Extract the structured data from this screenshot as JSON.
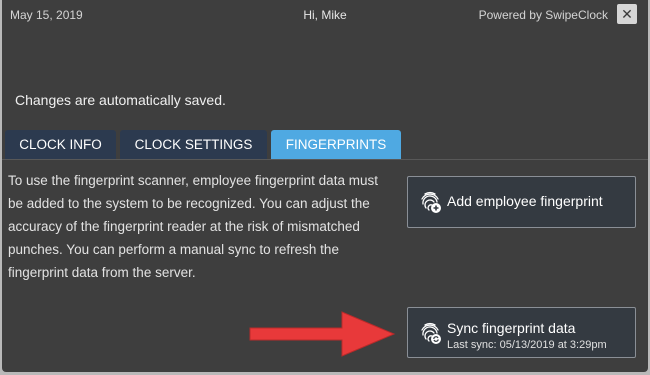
{
  "header": {
    "date": "May 15, 2019",
    "greeting": "Hi, Mike",
    "powered_by": "Powered by SwipeClock",
    "close_glyph": "✕"
  },
  "notice": "Changes are automatically saved.",
  "tabs": [
    {
      "label": "CLOCK INFO",
      "active": false
    },
    {
      "label": "CLOCK SETTINGS",
      "active": false
    },
    {
      "label": "FINGERPRINTS",
      "active": true
    }
  ],
  "description": "To use the fingerprint scanner, employee fingerprint data must be added to the system to be recognized. You can adjust the accuracy of the fingerprint reader at the risk of mismatched punches. You can perform a manual sync to refresh the fingerprint data from the server.",
  "buttons": {
    "add": {
      "label": "Add employee fingerprint",
      "icon": "fingerprint-add-icon"
    },
    "sync": {
      "label": "Sync fingerprint data",
      "sublabel": "Last sync: 05/13/2019 at 3:29pm",
      "icon": "fingerprint-sync-icon"
    }
  },
  "annotation": {
    "icon": "red-arrow-icon",
    "color": "#e8393a"
  },
  "colors": {
    "panel": "#3e3e3e",
    "tab": "#2c3a4f",
    "tab_active": "#4fa9e2",
    "button": "#343a41"
  }
}
